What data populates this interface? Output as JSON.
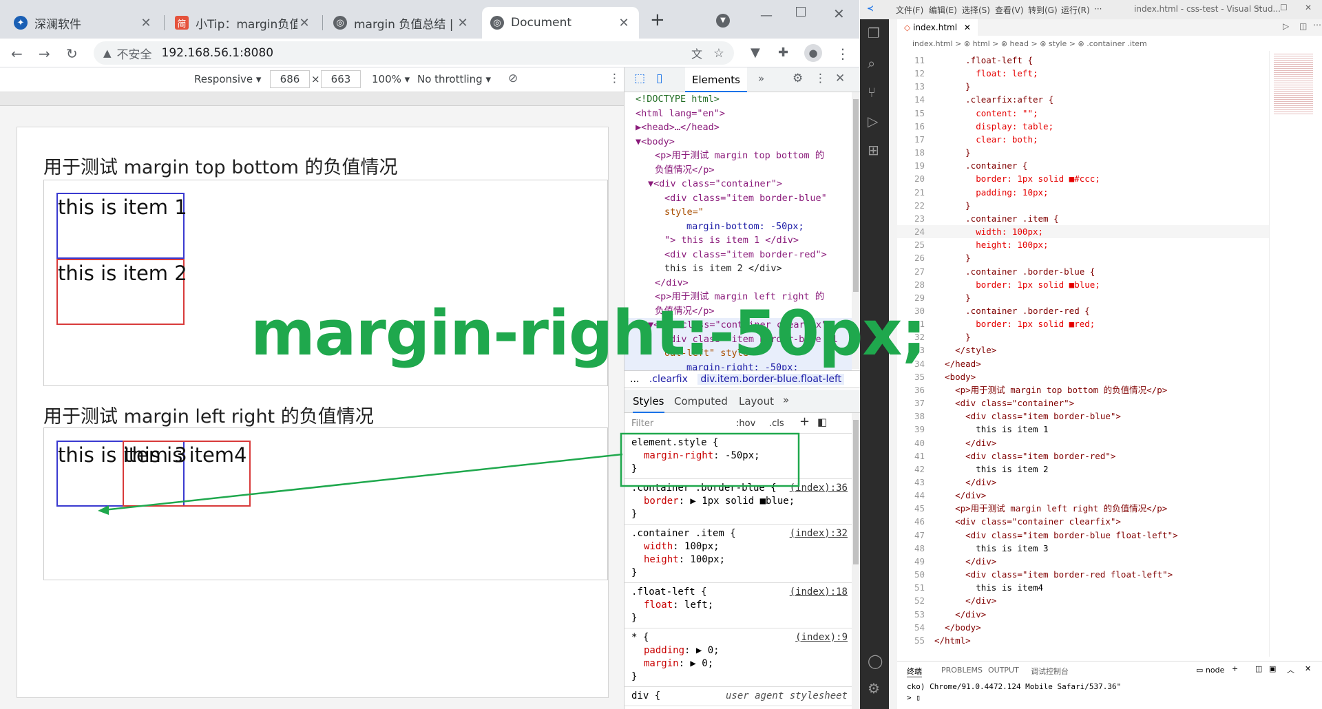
{
  "browser": {
    "tabs": [
      {
        "title": "深澜软件",
        "icon": "shenlan-icon"
      },
      {
        "title": "小Tip：margin负值详",
        "icon": "jian-icon"
      },
      {
        "title": "margin 负值总结 | 码",
        "icon": "globe-icon"
      },
      {
        "title": "Document",
        "icon": "globe-icon"
      }
    ],
    "address": {
      "security": "不安全",
      "url": "192.168.56.1:8080"
    },
    "emulation": {
      "device": "Responsive",
      "width": "686",
      "times": "×",
      "height": "663",
      "zoom": "100%",
      "throttle": "No throttling"
    }
  },
  "page": {
    "title1": "用于测试 margin top bottom 的负值情况",
    "item1": "this is item 1",
    "item2": "this is item 2",
    "title2": "用于测试 margin left right 的负值情况",
    "item3": "this is item 3",
    "item4": "this is item4"
  },
  "annotation": "margin-right:-50px;",
  "devtools": {
    "tab_elements": "Elements",
    "dom_lines": [
      "<!DOCTYPE html>",
      "<html lang=\"en\">",
      "▶<head>…</head>",
      "▼<body>",
      "<p>用于测试 margin top bottom 的",
      "负值情况</p>",
      "▼<div class=\"container\">",
      "<div class=\"item border-blue\"",
      "style=\"",
      "margin-bottom: -50px;",
      "\"> this is item 1 </div>",
      "<div class=\"item border-red\">",
      "this is item 2 </div>",
      "</div>",
      "<p>用于测试 margin left right 的",
      "负值情况</p>",
      "▼<div class=\"container clearfix\">",
      "<div class=\"item border-blue fl",
      "oat-left\" style=\"",
      "margin-right: -50px;"
    ],
    "crumbs": [
      "...",
      ".clearfix",
      "div.item.border-blue.float-left",
      "..."
    ],
    "style_tabs": [
      "Styles",
      "Computed",
      "Layout"
    ],
    "filter": "Filter",
    "hov": ":hov",
    "cls": ".cls",
    "rules": [
      {
        "selector": "element.style {",
        "props": [
          [
            "margin-right",
            "-50px;"
          ]
        ],
        "src": ""
      },
      {
        "selector": ".container .border-blue {",
        "props": [
          [
            "border",
            "▶ 1px solid ■blue;"
          ]
        ],
        "src": "(index):36"
      },
      {
        "selector": ".container .item {",
        "props": [
          [
            "width",
            "100px;"
          ],
          [
            "height",
            "100px;"
          ]
        ],
        "src": "(index):32"
      },
      {
        "selector": ".float-left {",
        "props": [
          [
            "float",
            "left;"
          ]
        ],
        "src": "(index):18"
      },
      {
        "selector": "* {",
        "props": [
          [
            "padding",
            "▶ 0;"
          ],
          [
            "margin",
            "▶ 0;"
          ]
        ],
        "src": "(index):9"
      },
      {
        "selector": "div {",
        "props": [],
        "src": "user agent stylesheet"
      }
    ]
  },
  "vscode": {
    "menu": [
      "文件(F)",
      "编辑(E)",
      "选择(S)",
      "查看(V)",
      "转到(G)",
      "运行(R)",
      "···"
    ],
    "title": "index.html - css-test - Visual Stud...",
    "tab": "index.html",
    "breadcrumb": "index.html > ⊗ html > ⊗ head > ⊗ style > ⊗ .container .item",
    "lines": [
      {
        "n": "11",
        "t": "      .float-left {"
      },
      {
        "n": "12",
        "t": "        float: left;"
      },
      {
        "n": "13",
        "t": "      }"
      },
      {
        "n": "14",
        "t": "      .clearfix:after {"
      },
      {
        "n": "15",
        "t": "        content: \"\";"
      },
      {
        "n": "16",
        "t": "        display: table;"
      },
      {
        "n": "17",
        "t": "        clear: both;"
      },
      {
        "n": "18",
        "t": "      }"
      },
      {
        "n": "19",
        "t": "      .container {"
      },
      {
        "n": "20",
        "t": "        border: 1px solid ■#ccc;"
      },
      {
        "n": "21",
        "t": "        padding: 10px;"
      },
      {
        "n": "22",
        "t": "      }"
      },
      {
        "n": "23",
        "t": "      .container .item {"
      },
      {
        "n": "24",
        "t": "        width: 100px;"
      },
      {
        "n": "25",
        "t": "        height: 100px;"
      },
      {
        "n": "26",
        "t": "      }"
      },
      {
        "n": "27",
        "t": "      .container .border-blue {"
      },
      {
        "n": "28",
        "t": "        border: 1px solid ■blue;"
      },
      {
        "n": "29",
        "t": "      }"
      },
      {
        "n": "30",
        "t": "      .container .border-red {"
      },
      {
        "n": "31",
        "t": "        border: 1px solid ■red;"
      },
      {
        "n": "32",
        "t": "      }"
      },
      {
        "n": "33",
        "t": "    </style>"
      },
      {
        "n": "34",
        "t": "  </head>"
      },
      {
        "n": "35",
        "t": "  <body>"
      },
      {
        "n": "36",
        "t": "    <p>用于测试 margin top bottom 的负值情况</p>"
      },
      {
        "n": "37",
        "t": "    <div class=\"container\">"
      },
      {
        "n": "38",
        "t": "      <div class=\"item border-blue\">"
      },
      {
        "n": "39",
        "t": "        this is item 1"
      },
      {
        "n": "40",
        "t": "      </div>"
      },
      {
        "n": "41",
        "t": "      <div class=\"item border-red\">"
      },
      {
        "n": "42",
        "t": "        this is item 2"
      },
      {
        "n": "43",
        "t": "      </div>"
      },
      {
        "n": "44",
        "t": "    </div>"
      },
      {
        "n": "45",
        "t": "    <p>用于测试 margin left right 的负值情况</p>"
      },
      {
        "n": "46",
        "t": "    <div class=\"container clearfix\">"
      },
      {
        "n": "47",
        "t": "      <div class=\"item border-blue float-left\">"
      },
      {
        "n": "48",
        "t": "        this is item 3"
      },
      {
        "n": "49",
        "t": "      </div>"
      },
      {
        "n": "50",
        "t": "      <div class=\"item border-red float-left\">"
      },
      {
        "n": "51",
        "t": "        this is item4"
      },
      {
        "n": "52",
        "t": "      </div>"
      },
      {
        "n": "53",
        "t": "    </div>"
      },
      {
        "n": "54",
        "t": "  </body>"
      },
      {
        "n": "55",
        "t": "</html>"
      }
    ],
    "panel_tabs": [
      "终端",
      "PROBLEMS",
      "OUTPUT",
      "调试控制台"
    ],
    "panel_node": "node",
    "terminal_line": "cko) Chrome/91.0.4472.124 Mobile Safari/537.36\""
  },
  "colors": {
    "annotation": "#1fa84d",
    "blue_border": "#3a3ad0",
    "red_border": "#d83a3a",
    "accent": "#1a73e8"
  }
}
